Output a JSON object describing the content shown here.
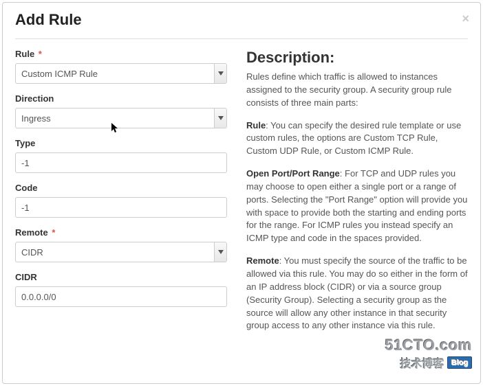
{
  "modal": {
    "title": "Add Rule",
    "close": "×"
  },
  "form": {
    "rule": {
      "label": "Rule",
      "required": "*",
      "value": "Custom ICMP Rule"
    },
    "direction": {
      "label": "Direction",
      "value": "Ingress"
    },
    "type": {
      "label": "Type",
      "value": "-1"
    },
    "code": {
      "label": "Code",
      "value": "-1"
    },
    "remote": {
      "label": "Remote",
      "required": "*",
      "value": "CIDR"
    },
    "cidr": {
      "label": "CIDR",
      "value": "0.0.0.0/0"
    }
  },
  "description": {
    "heading": "Description:",
    "intro": "Rules define which traffic is allowed to instances assigned to the security group. A security group rule consists of three main parts:",
    "rule_label": "Rule",
    "rule_text": ": You can specify the desired rule template or use custom rules, the options are Custom TCP Rule, Custom UDP Rule, or Custom ICMP Rule.",
    "port_label": "Open Port/Port Range",
    "port_text": ": For TCP and UDP rules you may choose to open either a single port or a range of ports. Selecting the \"Port Range\" option will provide you with space to provide both the starting and ending ports for the range. For ICMP rules you instead specify an ICMP type and code in the spaces provided.",
    "remote_label": "Remote",
    "remote_text": ": You must specify the source of the traffic to be allowed via this rule. You may do so either in the form of an IP address block (CIDR) or via a source group (Security Group). Selecting a security group as the source will allow any other instance in that security group access to any other instance via this rule."
  },
  "watermark": {
    "line1": "51CTO.com",
    "line2": "技术博客",
    "badge": "Blog"
  }
}
